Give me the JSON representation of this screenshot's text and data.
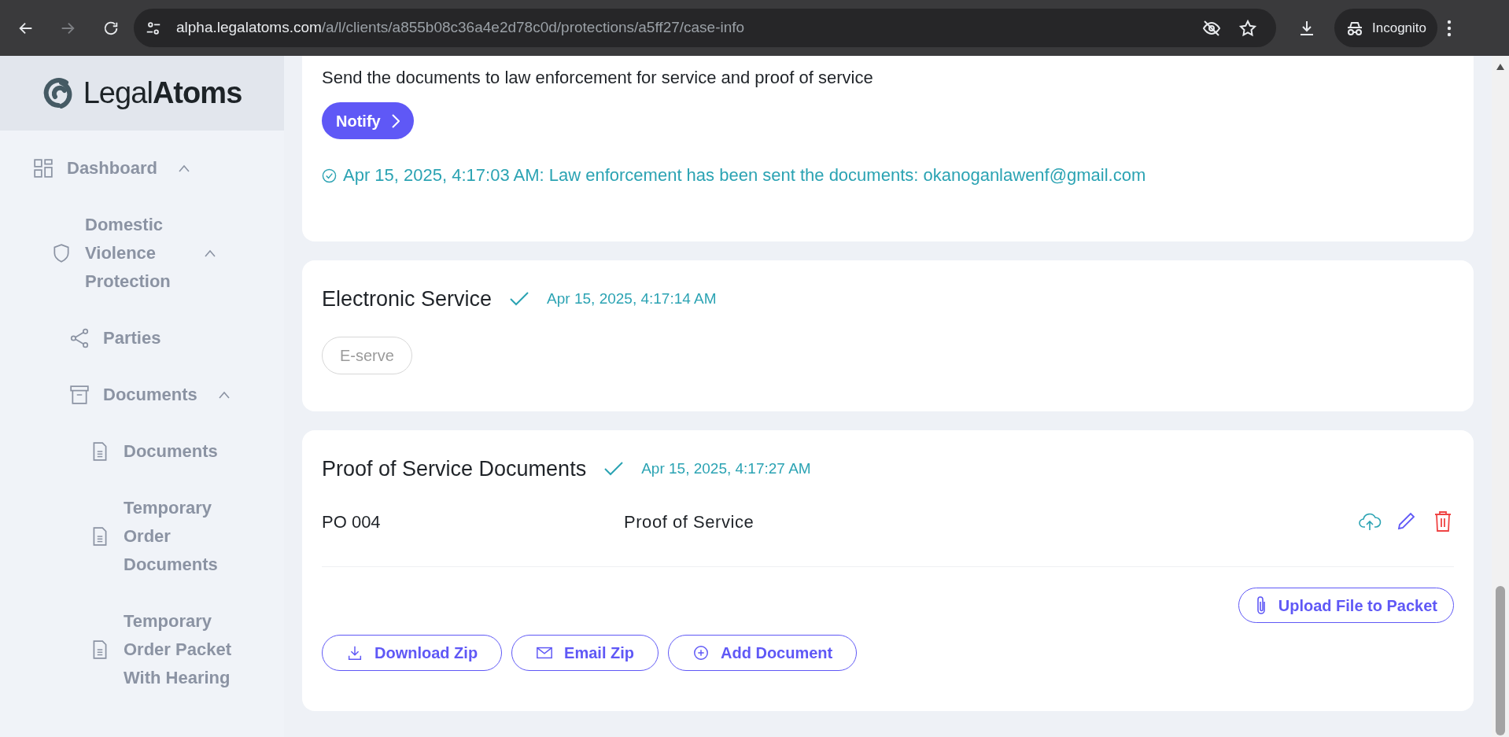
{
  "browser": {
    "url_host": "alpha.legalatoms.com",
    "url_path": "/a/l/clients/a855b08c36a4e2d78c0d/protections/a5ff27/case-info",
    "profile": "Incognito"
  },
  "sidebar": {
    "logo": "Legal**Atoms**",
    "items": [
      {
        "label": "Dashboard",
        "kind": "grid",
        "expanded": true,
        "children": [
          {
            "label": "Domestic Violence Protection",
            "kind": "shield",
            "expanded": true,
            "children": [
              {
                "label": "Parties",
                "kind": "share"
              },
              {
                "label": "Documents",
                "kind": "archive",
                "expanded": true,
                "children": [
                  {
                    "label": "Documents",
                    "kind": "file"
                  },
                  {
                    "label": "Temporary Order Documents",
                    "kind": "file"
                  },
                  {
                    "label": "Temporary Order Packet With Hearing",
                    "kind": "file"
                  }
                ]
              }
            ]
          }
        ]
      }
    ]
  },
  "cards": [
    {
      "kind": "notify",
      "text": "Send the documents to law enforcement for service and proof of service",
      "button": "Notify",
      "status": "Apr 15, 2025, 4:17:03 AM: Law enforcement has been sent the documents: okanoganlawenf@gmail.com"
    },
    {
      "kind": "service",
      "title": "Electronic Service",
      "completed": true,
      "date": "Apr 15, 2025, 4:17:14 AM",
      "chip": "E-serve"
    },
    {
      "kind": "documents",
      "title": "Proof of Service Documents",
      "completed": true,
      "date": "Apr 15, 2025, 4:17:27 AM",
      "rows": [
        {
          "code": "PO 004",
          "name": "Proof of Service"
        }
      ],
      "upload_button": "Upload File to Packet",
      "actions": [
        {
          "kind": "download",
          "label": "Download Zip"
        },
        {
          "kind": "email",
          "label": "Email Zip"
        },
        {
          "kind": "add",
          "label": "Add Document"
        }
      ]
    }
  ]
}
